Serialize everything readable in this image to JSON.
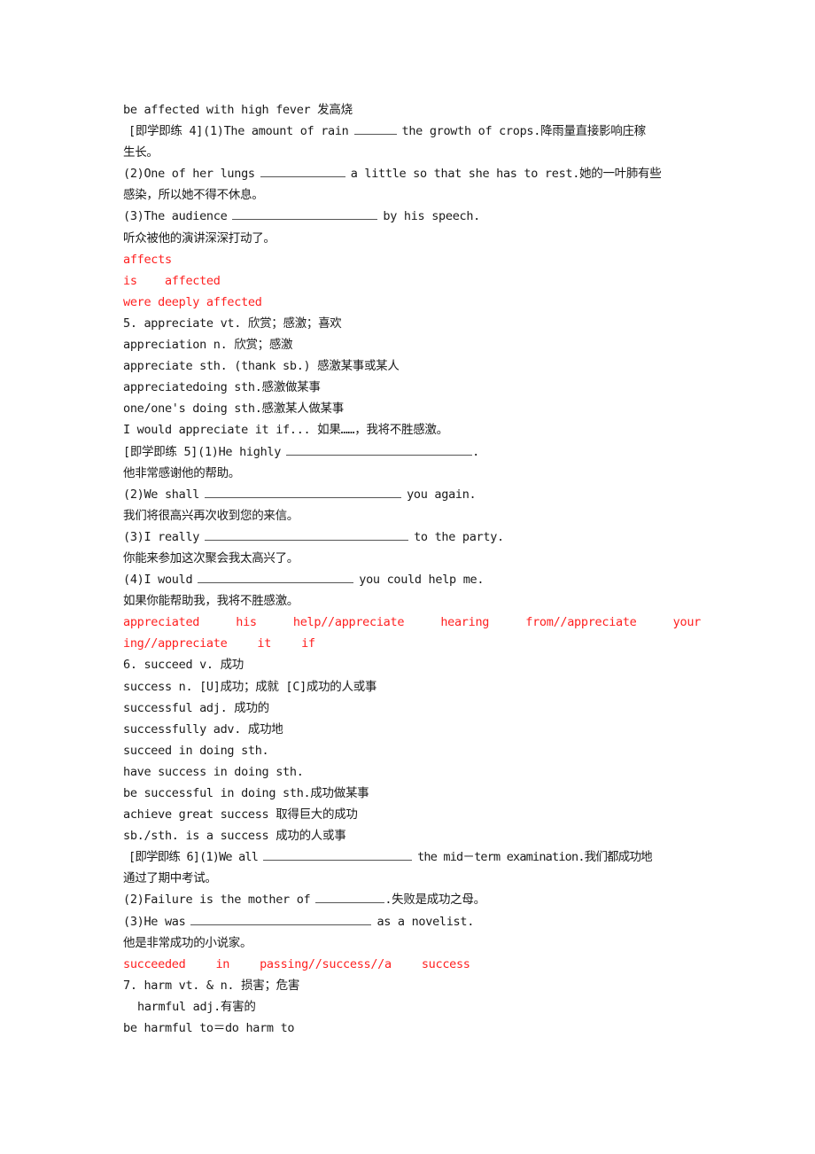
{
  "document": {
    "section4_tail": {
      "phrase": "be affected with high fever  发高烧",
      "exercise_label": "[即学即练 4]",
      "q1_pre": "(1)The amount of rain",
      "q1_post": "the growth of crops.降雨量直接影响庄稼",
      "q1_cont": "生长。",
      "q2_pre": "(2)One of her lungs",
      "q2_post": "a little so that she has to rest.她的一叶肺有些",
      "q2_cont": "感染，所以她不得不休息。",
      "q3_pre": "(3)The audience",
      "q3_post": "by his speech.",
      "q3_cn": "听众被他的演讲深深打动了。",
      "answers": [
        "affects",
        "is    affected",
        "were deeply affected"
      ]
    },
    "section5": {
      "heading": "5. appreciate vt. 欣赏；感激；喜欢",
      "items": [
        "appreciation n. 欣赏；感激",
        "appreciate sth. (thank sb.) 感激某事或某人",
        "appreciatedoing sth.感激做某事",
        "one/one's doing sth.感激某人做某事",
        "I would appreciate it if... 如果……，我将不胜感激。"
      ],
      "exercise_label": "[即学即练 5]",
      "q1_pre": "(1)He highly",
      "q1_post": ".",
      "q1_cn": "他非常感谢他的帮助。",
      "q2_pre": "(2)We shall",
      "q2_post": "you again.",
      "q2_cn": "我们将很高兴再次收到您的来信。",
      "q3_pre": "(3)I really",
      "q3_post": "to the party.",
      "q3_cn": "你能来参加这次聚会我太高兴了。",
      "q4_pre": "(4)I would",
      "q4_post": "you could help me.",
      "q4_cn": "如果你能帮助我，我将不胜感激。",
      "answer_line1": [
        "appreciated",
        "his",
        "help//appreciate",
        "hearing",
        "from//appreciate",
        "your"
      ],
      "answer_line2": [
        "ing//appreciate",
        "it",
        "if"
      ]
    },
    "section6": {
      "heading": "6. succeed v. 成功",
      "items": [
        "success n. [U]成功；成就 [C]成功的人或事",
        "successful adj. 成功的",
        "successfully adv. 成功地",
        "succeed in doing sth.",
        "have success in doing sth.",
        "be successful in doing sth.成功做某事",
        "achieve great success 取得巨大的成功",
        "sb./sth. is a success 成功的人或事"
      ],
      "exercise_label": "[即学即练 6]",
      "q1_pre": "(1)We all",
      "q1_post": "the mid－term examination.我们都成功地",
      "q1_cont": "通过了期中考试。",
      "q2_pre": "(2)Failure is the mother of",
      "q2_post": ".失败是成功之母。",
      "q3_pre": "(3)He was",
      "q3_post": "as a novelist.",
      "q3_cn": "他是非常成功的小说家。",
      "answer_line": [
        "succeeded",
        "in",
        "passing//success//a",
        "success"
      ]
    },
    "section7": {
      "heading": "7. harm vt. & n. 损害；危害",
      "items": [
        "harmful adj.有害的",
        "be harmful to＝do harm to"
      ]
    }
  },
  "colors": {
    "text": "#1a1a1a",
    "answer": "#ff2020"
  }
}
